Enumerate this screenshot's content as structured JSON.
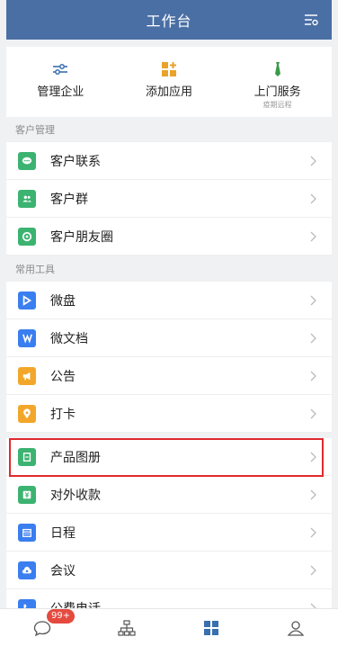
{
  "header": {
    "title": "工作台",
    "settings_icon": "settings-list-icon"
  },
  "quick_actions": [
    {
      "label": "管理企业",
      "sub": "",
      "icon": "sliders-icon"
    },
    {
      "label": "添加应用",
      "sub": "",
      "icon": "add-app-icon"
    },
    {
      "label": "上门服务",
      "sub": "疫期远程",
      "icon": "tie-icon"
    }
  ],
  "sections": {
    "customer": "客户管理",
    "tools": "常用工具"
  },
  "customer_items": [
    {
      "label": "客户联系",
      "icon": "chat-bubble-icon",
      "color": "#3cb371"
    },
    {
      "label": "客户群",
      "icon": "group-icon",
      "color": "#3cb371"
    },
    {
      "label": "客户朋友圈",
      "icon": "camera-aperture-icon",
      "color": "#3cb371"
    }
  ],
  "tool_items": [
    {
      "label": "微盘",
      "icon": "drive-icon",
      "color": "#3a7ef0"
    },
    {
      "label": "微文档",
      "icon": "doc-w-icon",
      "color": "#3a7ef0"
    },
    {
      "label": "公告",
      "icon": "megaphone-icon",
      "color": "#f2a72a"
    },
    {
      "label": "打卡",
      "icon": "location-pin-icon",
      "color": "#f2a72a"
    },
    {
      "label": "产品图册",
      "icon": "album-icon",
      "color": "#3cb371"
    },
    {
      "label": "对外收款",
      "icon": "payment-icon",
      "color": "#3cb371"
    },
    {
      "label": "日程",
      "icon": "calendar-icon",
      "color": "#3a7ef0"
    },
    {
      "label": "会议",
      "icon": "cloud-meeting-icon",
      "color": "#3a7ef0"
    },
    {
      "label": "公费电话",
      "icon": "phone-icon",
      "color": "#3a7ef0"
    }
  ],
  "tabbar": {
    "badge": "99+",
    "tabs": [
      "messages-tab",
      "contacts-tab",
      "workbench-tab",
      "me-tab"
    ]
  }
}
